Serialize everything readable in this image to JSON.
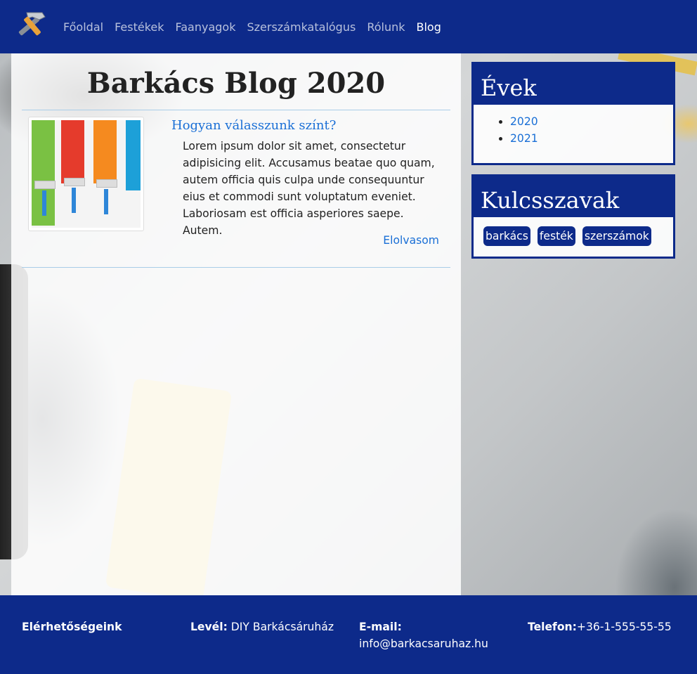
{
  "nav": {
    "logo_icon": "hammer-icon",
    "items": [
      {
        "label": "Főoldal",
        "active": false
      },
      {
        "label": "Festékek",
        "active": false
      },
      {
        "label": "Faanyagok",
        "active": false
      },
      {
        "label": "Szerszámkatalógus",
        "active": false
      },
      {
        "label": "Rólunk",
        "active": false
      },
      {
        "label": "Blog",
        "active": true
      }
    ]
  },
  "main": {
    "title": "Barkács Blog 2020",
    "post": {
      "title": "Hogyan válasszunk színt?",
      "excerpt": "Lorem ipsum dolor sit amet, consectetur adipisicing elit. Accusamus beatae quo quam, autem officia quis culpa unde consequuntur eius et commodi sunt voluptatum eveniet. Laboriosam est officia asperiores saepe. Autem.",
      "read_more": "Elolvasom"
    }
  },
  "sidebar": {
    "years": {
      "title": "Évek",
      "items": [
        "2020",
        "2021"
      ]
    },
    "keywords": {
      "title": "Kulcsszavak",
      "tags": [
        "barkács",
        "festék",
        "szerszámok"
      ]
    }
  },
  "footer": {
    "contacts_label": "Elérhetőségeink",
    "letter_label": "Levél:",
    "letter_value": " DIY Barkácsáruház",
    "email_label": "E-mail:",
    "email_value": "info@barkacsaruhaz.hu",
    "phone_label": "Telefon:",
    "phone_value": "+36-1-555-55-55"
  },
  "colors": {
    "nav_bg": "#0d2a8a",
    "link": "#1a6fd6",
    "rule": "#a9cde8"
  }
}
